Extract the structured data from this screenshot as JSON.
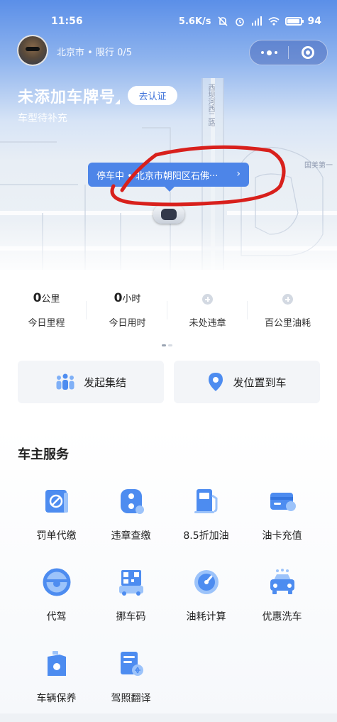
{
  "status_bar": {
    "time": "11:56",
    "network_speed": "5.6K/s",
    "battery_level": 0.94,
    "battery_text": "94"
  },
  "header": {
    "city_line": "北京市 • 限行 0/5",
    "plate": "未添加车牌号",
    "certify_button": "去认证",
    "subtitle": "车型待补充"
  },
  "map": {
    "road_vertical": "西坝河西二路",
    "road_right": "国美第一",
    "parking_text": "停车中 • 北京市朝阳区石佛···",
    "parking_arrow": "›",
    "annotation_color": "#d8201c"
  },
  "stats": [
    {
      "value": "0",
      "unit": "公里",
      "label": "今日里程"
    },
    {
      "value": "0",
      "unit": "小时",
      "label": "今日用时"
    },
    {
      "value": "",
      "unit": "",
      "label": "未处违章"
    },
    {
      "value": "",
      "unit": "",
      "label": "百公里油耗"
    }
  ],
  "actions": {
    "rally": "发起集结",
    "send_location": "发位置到车"
  },
  "services": {
    "title": "车主服务",
    "items": [
      {
        "label": "罚单代缴",
        "icon": "ticket-icon"
      },
      {
        "label": "违章查缴",
        "icon": "traffic-light-icon"
      },
      {
        "label": "8.5折加油",
        "icon": "fuel-pump-icon"
      },
      {
        "label": "油卡充值",
        "icon": "fuel-card-icon"
      },
      {
        "label": "代驾",
        "icon": "steering-wheel-icon"
      },
      {
        "label": "挪车码",
        "icon": "qr-code-icon"
      },
      {
        "label": "油耗计算",
        "icon": "gauge-icon"
      },
      {
        "label": "优惠洗车",
        "icon": "car-wash-icon"
      },
      {
        "label": "车辆保养",
        "icon": "oil-can-icon"
      },
      {
        "label": "驾照翻译",
        "icon": "license-translate-icon"
      }
    ]
  },
  "colors": {
    "accent": "#3a6fd8",
    "icon_blue": "#4d8cf0"
  }
}
